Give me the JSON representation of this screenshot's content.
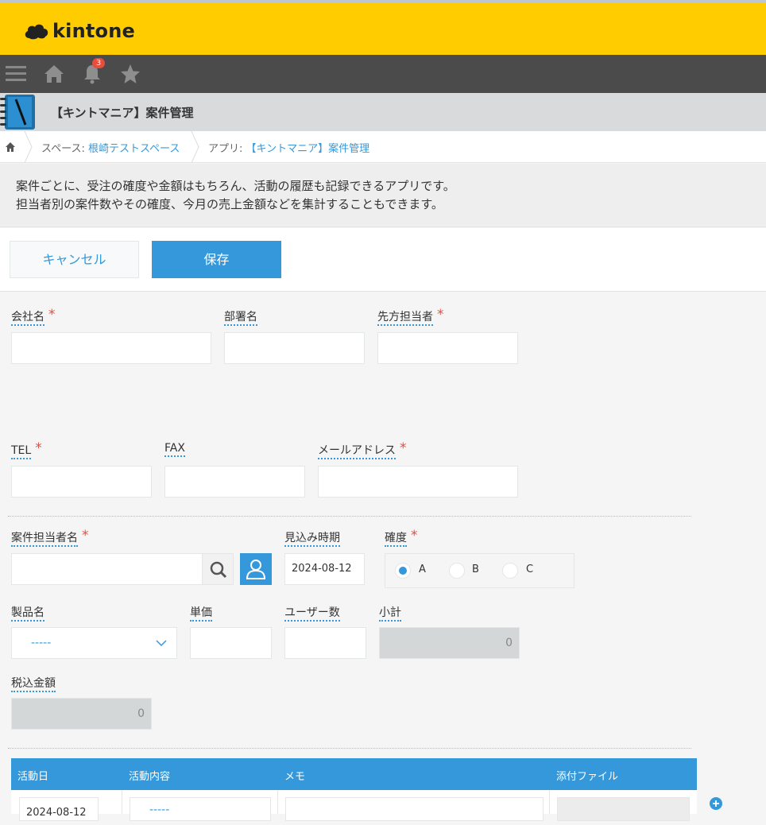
{
  "brand": {
    "name": "kintone"
  },
  "global_nav": {
    "notification_count": "3"
  },
  "app": {
    "title": "【キントマニア】案件管理"
  },
  "breadcrumb": {
    "space_prefix": "スペース: ",
    "space_name": "根崎テストスペース",
    "app_prefix": "アプリ: ",
    "app_name": "【キントマニア】案件管理"
  },
  "description": {
    "line1": "案件ごとに、受注の確度や金額はもちろん、活動の履歴も記録できるアプリです。",
    "line2": "担当者別の案件数やその確度、今月の売上金額などを集計することもできます。"
  },
  "toolbar": {
    "cancel_label": "キャンセル",
    "save_label": "保存"
  },
  "fields": {
    "company": {
      "label": "会社名"
    },
    "department": {
      "label": "部署名"
    },
    "contact": {
      "label": "先方担当者"
    },
    "tel": {
      "label": "TEL"
    },
    "fax": {
      "label": "FAX"
    },
    "email": {
      "label": "メールアドレス"
    },
    "owner": {
      "label": "案件担当者名"
    },
    "expected_date": {
      "label": "見込み時期",
      "value": "2024-08-12"
    },
    "confidence": {
      "label": "確度",
      "options": [
        "A",
        "B",
        "C"
      ],
      "selected": "A"
    },
    "product": {
      "label": "製品名",
      "value": "-----"
    },
    "unit_price": {
      "label": "単価"
    },
    "users": {
      "label": "ユーザー数"
    },
    "subtotal": {
      "label": "小計",
      "value": "0"
    },
    "total_tax": {
      "label": "税込金額",
      "value": "0"
    }
  },
  "activity_table": {
    "columns": [
      "活動日",
      "活動内容",
      "メモ",
      "添付ファイル"
    ],
    "row": {
      "date": "2024-08-12",
      "content": "-----"
    }
  },
  "colors": {
    "header": "#ffcc00",
    "nav": "#4b4b4b",
    "accent": "#3498db",
    "required": "#e74c3c"
  }
}
